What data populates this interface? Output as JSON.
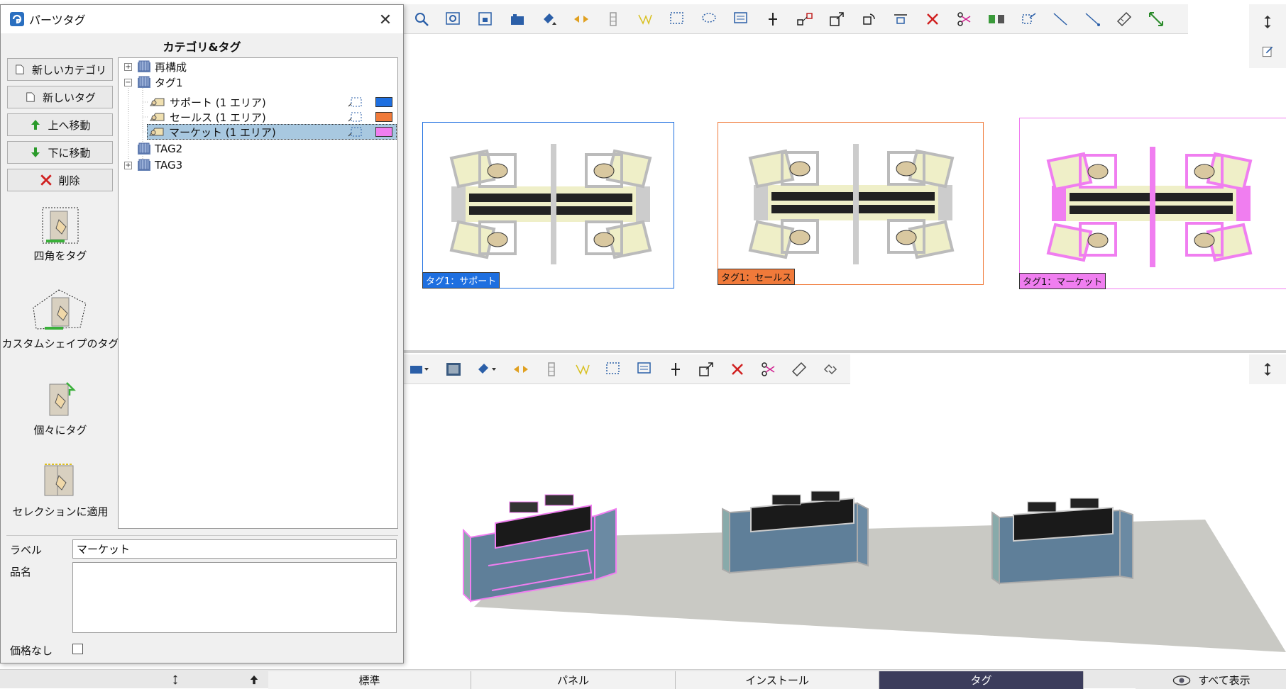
{
  "dialog": {
    "title": "パーツタグ",
    "section_title": "カテゴリ&タグ",
    "buttons": {
      "new_category": "新しいカテゴリ",
      "new_tag": "新しいタグ",
      "move_up": "上へ移動",
      "move_down": "下に移動",
      "delete": "削除"
    },
    "tools": {
      "rect_tag": "四角をタグ",
      "custom_shape_tag": "カスタムシェイプのタグ",
      "individual_tag": "個々にタグ",
      "apply_selection": "セレクションに適用"
    },
    "tree": {
      "items": [
        {
          "label": "再構成",
          "expander": "+"
        },
        {
          "label": "タグ1",
          "expander": "−"
        },
        {
          "label": "サポート (1 エリア)",
          "color": "#1e6fe0"
        },
        {
          "label": "セールス (1 エリア)",
          "color": "#f07a3a"
        },
        {
          "label": "マーケット (1 エリア)",
          "color": "#f07ef0"
        },
        {
          "label": "TAG2"
        },
        {
          "label": "TAG3",
          "expander": "+"
        }
      ]
    },
    "fields": {
      "label_caption": "ラベル",
      "label_value": "マーケット",
      "name_caption": "品名",
      "name_value": "",
      "noprice_caption": "価格なし"
    }
  },
  "plan": {
    "tags": [
      {
        "label": "タグ1：サポート",
        "color": "#1e6fe0"
      },
      {
        "label": "タグ1：セールス",
        "color": "#f07a3a"
      },
      {
        "label": "タグ1：マーケット",
        "color": "#f07ef0"
      }
    ]
  },
  "bottom_tabs": {
    "standard": "標準",
    "panel": "パネル",
    "install": "インストール",
    "tag": "タグ",
    "show_all": "すべて表示"
  }
}
